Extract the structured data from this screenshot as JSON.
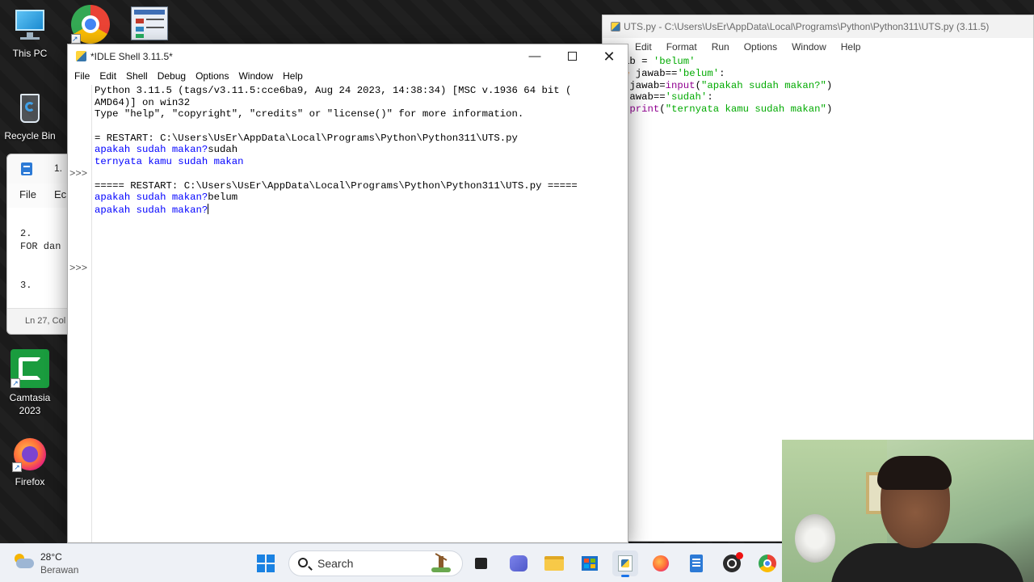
{
  "desktop": {
    "icons": [
      {
        "label": "This PC",
        "icon": "this-pc-icon"
      },
      {
        "label": "Recycle Bin",
        "icon": "recycle-bin-icon"
      },
      {
        "label": "Camtasia\n2023",
        "icon": "camtasia-icon"
      },
      {
        "label": "Firefox",
        "icon": "firefox-icon"
      }
    ]
  },
  "notepad": {
    "tab_label": "1.",
    "menu": [
      "File",
      "Ec"
    ],
    "body_text": "2.\nFOR dan\n\n\n3.",
    "status": "Ln 27, Col"
  },
  "idle_shell": {
    "title": "*IDLE Shell 3.11.5*",
    "menu": [
      "File",
      "Edit",
      "Shell",
      "Debug",
      "Options",
      "Window",
      "Help"
    ],
    "prompt": ">>>",
    "lines": [
      {
        "text": "Python 3.11.5 (tags/v3.11.5:cce6ba9, Aug 24 2023, 14:38:34) [MSC v.1936 64 bit (",
        "color": "#000000"
      },
      {
        "text": "AMD64)] on win32",
        "color": "#000000"
      },
      {
        "text": "Type \"help\", \"copyright\", \"credits\" or \"license()\" for more information.",
        "color": "#000000"
      },
      {
        "text": "",
        "color": "#000000"
      },
      {
        "text": "= RESTART: C:\\Users\\UsEr\\AppData\\Local\\Programs\\Python\\Python311\\UTS.py",
        "color": "#000000"
      },
      {
        "text": "apakah sudah makan?",
        "color": "#0000ff",
        "input": "sudah"
      },
      {
        "text": "ternyata kamu sudah makan",
        "color": "#0000ff"
      },
      {
        "text": "",
        "color": "#000000"
      },
      {
        "text": "===== RESTART: C:\\Users\\UsEr\\AppData\\Local\\Programs\\Python\\Python311\\UTS.py =====",
        "color": "#000000"
      },
      {
        "text": "apakah sudah makan?",
        "color": "#0000ff",
        "input": "belum"
      },
      {
        "text": "apakah sudah makan?",
        "color": "#0000ff",
        "cursor": true
      }
    ]
  },
  "editor": {
    "title": "UTS.py - C:\\Users\\UsEr\\AppData\\Local\\Programs\\Python\\Python311\\UTS.py (3.11.5)",
    "menu": [
      "Edit",
      "Format",
      "Run",
      "Options",
      "Window",
      "Help"
    ],
    "code": [
      "ab = 'belum'",
      "e jawab=='belum':",
      " jawab=input(\"apakah sudah makan?\")",
      "jawab=='sudah':",
      " print(\"ternyata kamu sudah makan\")"
    ]
  },
  "taskbar": {
    "weather_temp": "28°C",
    "weather_desc": "Berawan",
    "search_label": "Search",
    "apps": [
      "start-icon",
      "task-view-icon",
      "teams-icon",
      "file-explorer-icon",
      "store-icon",
      "python-idle-icon",
      "firefox-icon",
      "notepad-icon",
      "obs-icon",
      "chrome-icon"
    ]
  }
}
